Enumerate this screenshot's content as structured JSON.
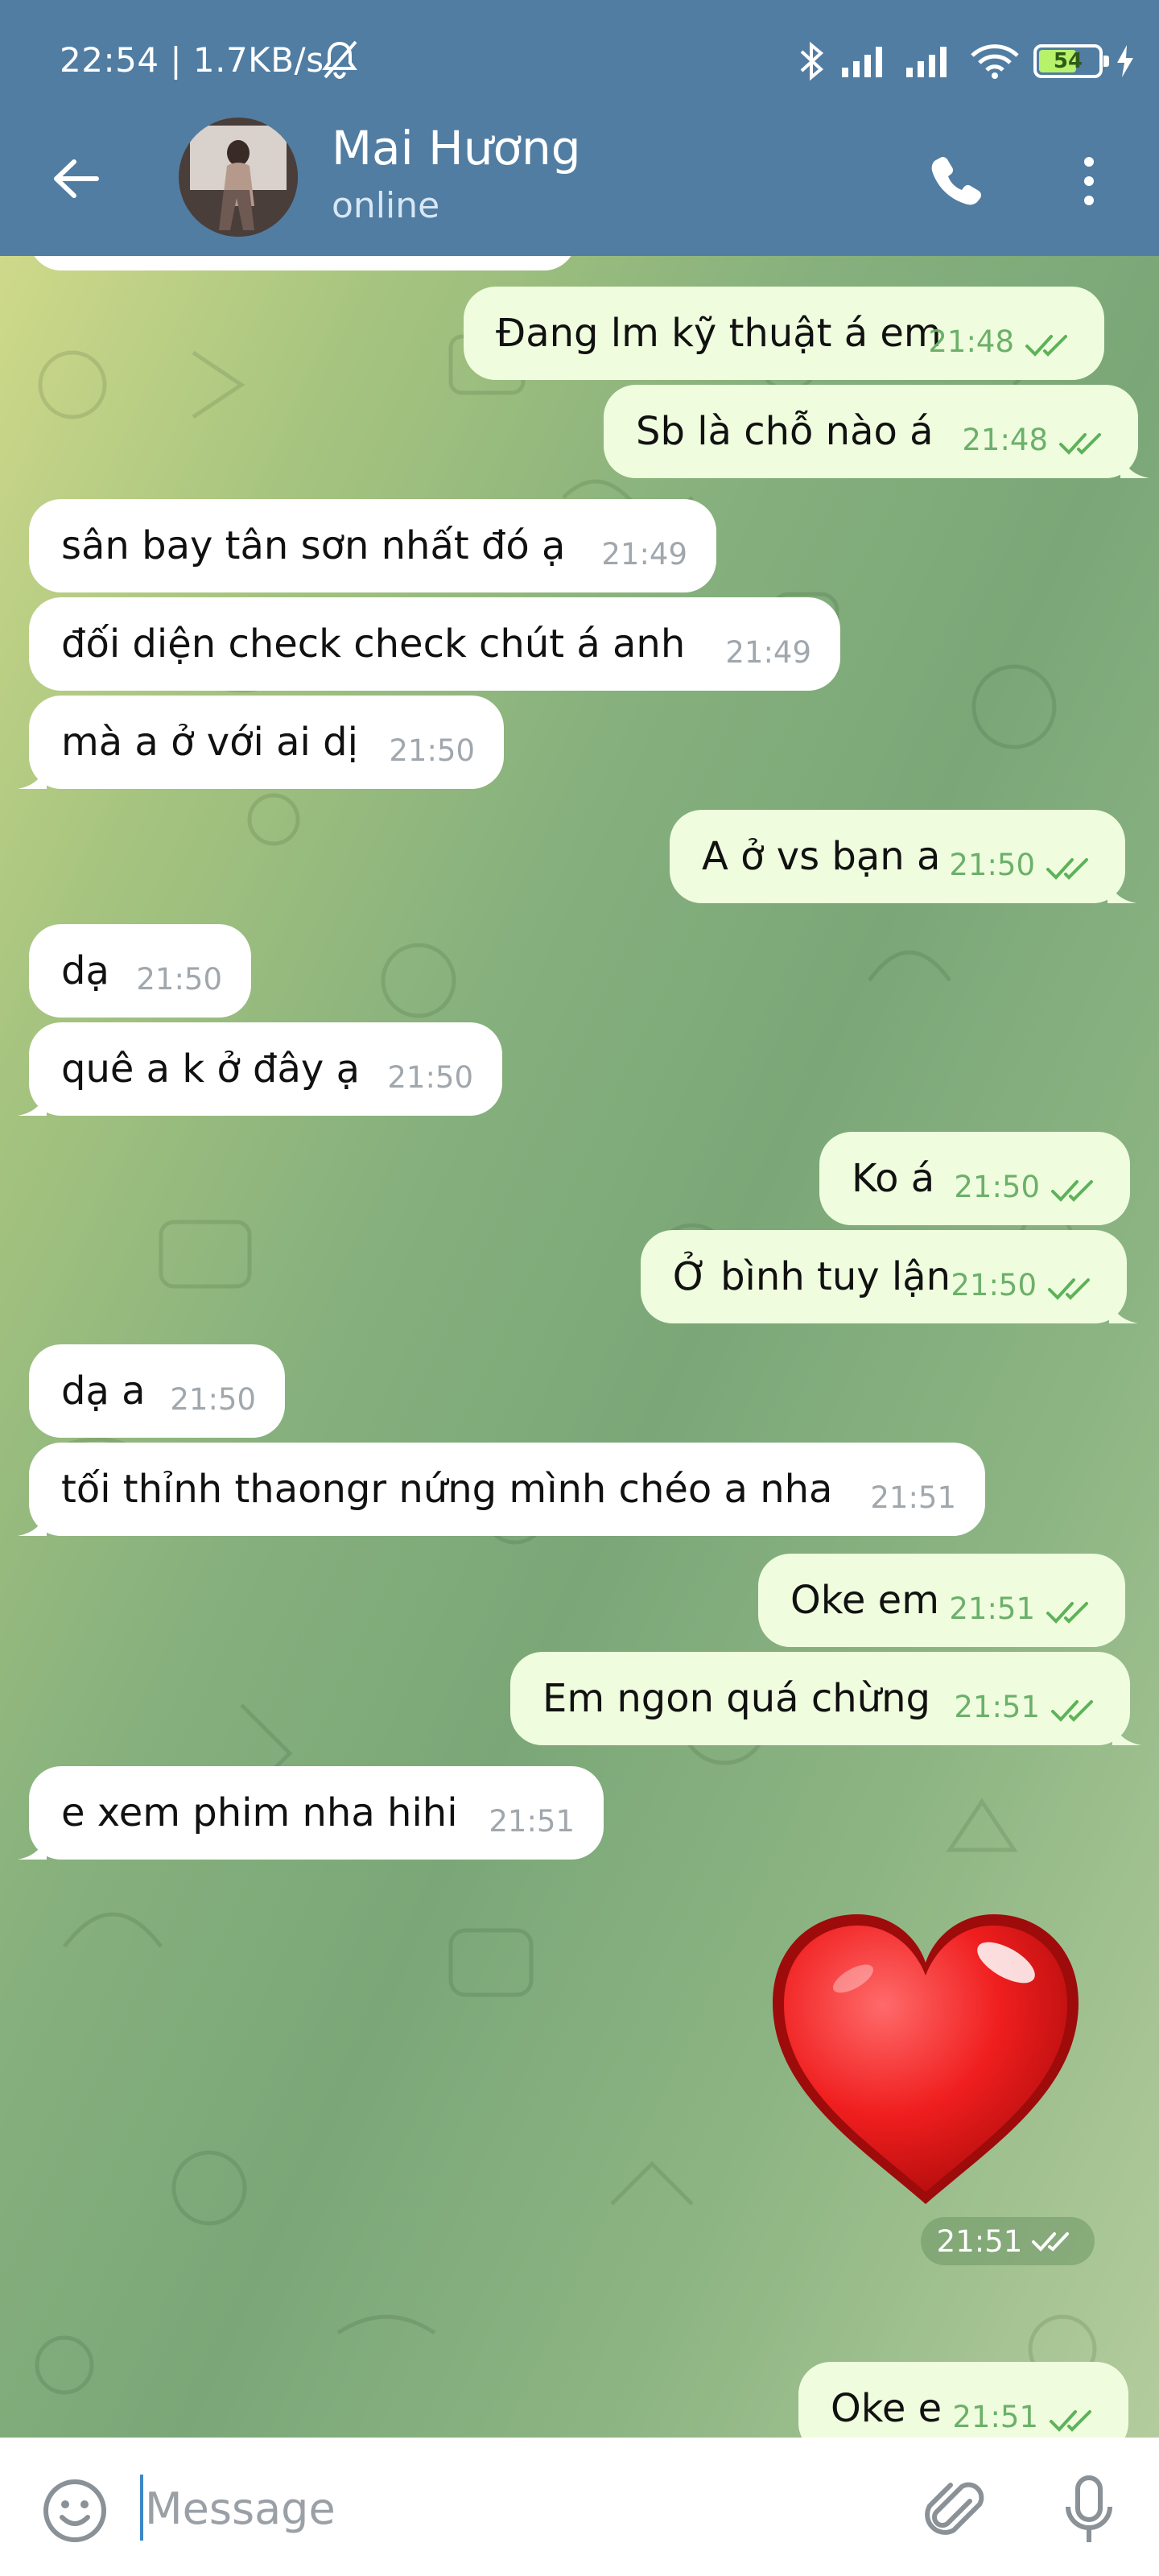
{
  "status_bar": {
    "time_speed": "22:54 | 1.7KB/s",
    "battery": "54"
  },
  "header": {
    "contact_name": "Mai Hương",
    "contact_status": "online"
  },
  "messages": [
    {
      "dir": "out",
      "text": "Đang lm kỹ thuật á em",
      "time": "21:48"
    },
    {
      "dir": "out",
      "text": "Sb là chỗ nào á",
      "time": "21:48"
    },
    {
      "dir": "in",
      "text": "sân bay tân sơn nhất đó ạ",
      "time": "21:49"
    },
    {
      "dir": "in",
      "text": "đối diện check check chút á anh",
      "time": "21:49"
    },
    {
      "dir": "in",
      "text": "mà a ở với ai dị",
      "time": "21:50"
    },
    {
      "dir": "out",
      "text": "A ở vs bạn a",
      "time": "21:50"
    },
    {
      "dir": "in",
      "text": "dạ",
      "time": "21:50"
    },
    {
      "dir": "in",
      "text": "quê a k ở đây ạ",
      "time": "21:50"
    },
    {
      "dir": "out",
      "text": "Ko á",
      "time": "21:50"
    },
    {
      "dir": "out",
      "text": "Ở bình tuy lận",
      "time": "21:50"
    },
    {
      "dir": "in",
      "text": "dạ a",
      "time": "21:50"
    },
    {
      "dir": "in",
      "text": "tối thỉnh thaongr nứng mình chéo a nha",
      "time": "21:51"
    },
    {
      "dir": "out",
      "text": "Oke em",
      "time": "21:51"
    },
    {
      "dir": "out",
      "text": "Em ngon quá chừng",
      "time": "21:51"
    },
    {
      "dir": "in",
      "text": "e xem phim nha hihi",
      "time": "21:51"
    },
    {
      "dir": "out",
      "text": "Oke e",
      "time": "21:51"
    }
  ],
  "sticker": {
    "icon": "heart-sticker",
    "time": "21:51"
  },
  "input": {
    "placeholder": "Message"
  },
  "colors": {
    "header": "#517da2",
    "outgoing_bubble": "#effdde",
    "incoming_bubble": "#ffffff",
    "outgoing_meta": "#6cb06a"
  }
}
